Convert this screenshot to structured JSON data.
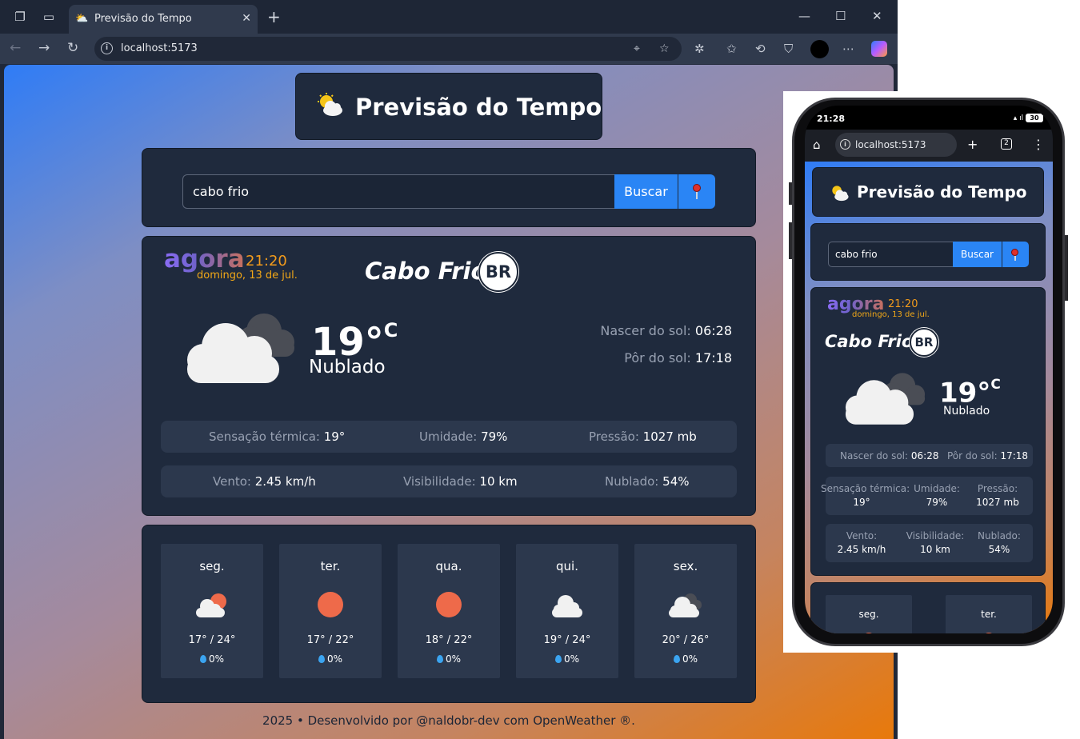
{
  "browser": {
    "tab_title": "Previsão do Tempo",
    "url": "localhost:5173",
    "window_controls": {
      "minimize": "—",
      "maximize": "☐",
      "close": "✕"
    }
  },
  "app": {
    "title": "Previsão do Tempo",
    "search": {
      "value": "cabo frio",
      "button_label": "Buscar",
      "location_icon": "pin-icon"
    },
    "current": {
      "agora_label": "agora",
      "time": "21:20",
      "date": "domingo, 13 de jul.",
      "city": "Cabo Frio",
      "country": "BR",
      "temperature": "19°",
      "temperature_unit": "C",
      "description": "Nublado",
      "icon": "cloudy-icon",
      "sunrise_label": "Nascer do sol:",
      "sunrise": "06:28",
      "sunset_label": "Pôr do sol:",
      "sunset": "17:18",
      "feels_like_label": "Sensação térmica:",
      "feels_like": "19°",
      "humidity_label": "Umidade:",
      "humidity": "79%",
      "pressure_label": "Pressão:",
      "pressure": "1027 mb",
      "wind_label": "Vento:",
      "wind": "2.45 km/h",
      "visibility_label": "Visibilidade:",
      "visibility": "10 km",
      "clouds_label": "Nublado:",
      "clouds": "54%"
    },
    "forecast": [
      {
        "day": "seg.",
        "temps": "17° / 24°",
        "rain": "0%",
        "icon": "partly-cloudy-icon"
      },
      {
        "day": "ter.",
        "temps": "17° / 22°",
        "rain": "0%",
        "icon": "sun-icon"
      },
      {
        "day": "qua.",
        "temps": "18° / 22°",
        "rain": "0%",
        "icon": "sun-icon"
      },
      {
        "day": "qui.",
        "temps": "19° / 24°",
        "rain": "0%",
        "icon": "cloud-icon"
      },
      {
        "day": "sex.",
        "temps": "20° / 26°",
        "rain": "0%",
        "icon": "cloudy-icon"
      }
    ],
    "footer": "2025 • Desenvolvido por @naldobr-dev com OpenWeather ®."
  },
  "phone": {
    "status_time": "21:28",
    "battery": "30",
    "url": "localhost:5173",
    "tabs_count": "2"
  },
  "colors": {
    "card_bg": "#1f2a3d",
    "stat_bg": "#2c384d",
    "accent_blue": "#2a85f5",
    "time_orange": "#f29b1c",
    "sun_color": "#ee6a4a"
  }
}
